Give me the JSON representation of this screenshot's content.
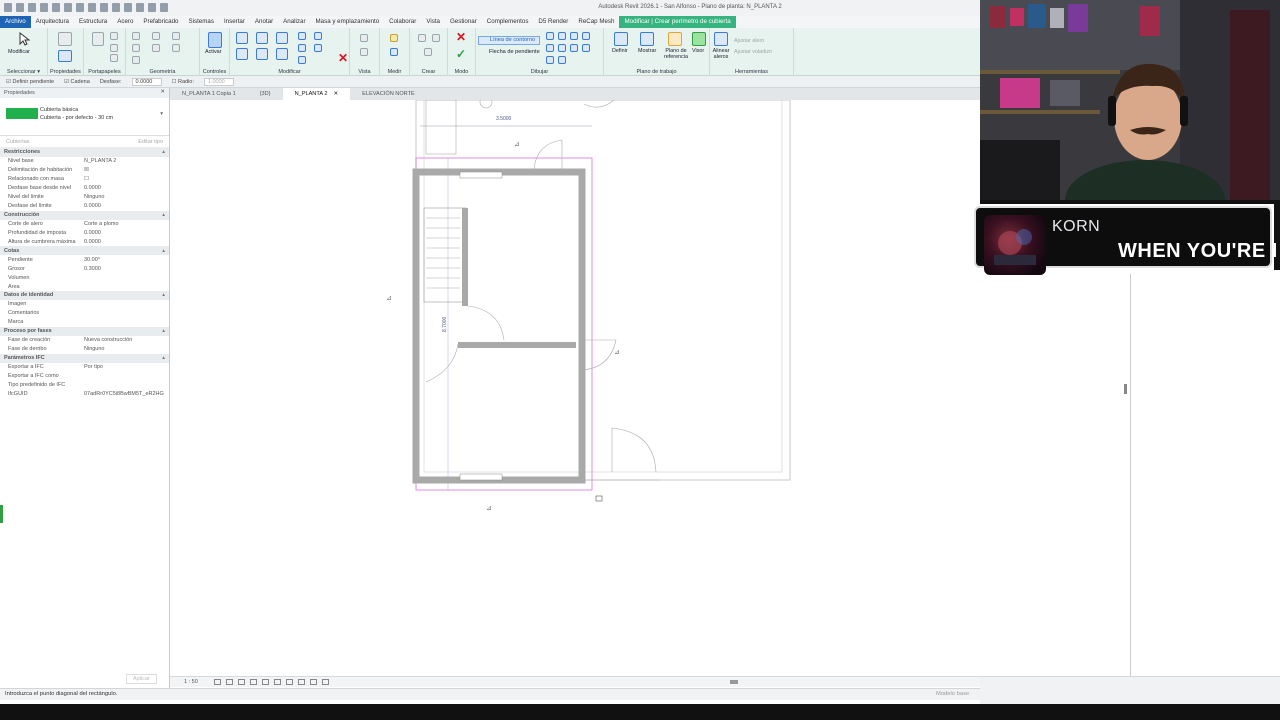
{
  "app": {
    "title": "Autodesk Revit 2026.1 - San Alfonso - Plano de planta: N_PLANTA 2"
  },
  "ribbon_tabs": [
    {
      "label": "Archivo",
      "state": "active"
    },
    {
      "label": "Arquitectura",
      "state": ""
    },
    {
      "label": "Estructura",
      "state": ""
    },
    {
      "label": "Acero",
      "state": ""
    },
    {
      "label": "Prefabricado",
      "state": ""
    },
    {
      "label": "Sistemas",
      "state": ""
    },
    {
      "label": "Insertar",
      "state": ""
    },
    {
      "label": "Anotar",
      "state": ""
    },
    {
      "label": "Analizar",
      "state": ""
    },
    {
      "label": "Masa y emplazamiento",
      "state": ""
    },
    {
      "label": "Colaborar",
      "state": ""
    },
    {
      "label": "Vista",
      "state": ""
    },
    {
      "label": "Gestionar",
      "state": ""
    },
    {
      "label": "Complementos",
      "state": ""
    },
    {
      "label": "D5 Render",
      "state": ""
    },
    {
      "label": "ReCap Mesh",
      "state": ""
    },
    {
      "label": "Modificar | Crear perímetro de cubierta",
      "state": "ctx"
    }
  ],
  "ribbon": {
    "modificar": "Modificar",
    "seleccionar": "Seleccionar ▾",
    "propiedades": "Propiedades",
    "portapapeles": "Portapapeles",
    "geometria": "Geometría",
    "activar": "Activar",
    "controles": "Controles",
    "modificar_group": "Modificar",
    "vista": "Vista",
    "medir": "Medir",
    "crear": "Crear",
    "modo": "Modo",
    "linea_contorno": "Línea de contorno",
    "flecha_pendiente": "Flecha de pendiente",
    "dibujar": "Dibujar",
    "definir": "Definir",
    "mostrar": "Mostrar",
    "plano_ref": "Plano de referencia",
    "visor": "Visor",
    "alinear_aleros": "Alinear aleros",
    "plano_trabajo": "Plano de trabajo",
    "herramientas": "Herramientas",
    "ajustar_alero": "Ajustar alero",
    "ajustar_voladizo": "Ajustar voladizo"
  },
  "options_bar": {
    "definir_pendiente": "Definir pendiente",
    "cadena": "Cadena",
    "desfase_label": "Desfase:",
    "desfase_value": "0.0000",
    "radio_label": "Radio:",
    "radio_value": "1.0000"
  },
  "properties": {
    "header": "Propiedades",
    "type_name": "Cubierta básica",
    "type_sub": "Cubierta - por defecto - 30 cm",
    "filter": "Cubiertas",
    "edit_type": "Editar tipo",
    "rows": [
      {
        "name": "Restricciones",
        "value": "",
        "sec": true
      },
      {
        "name": "Nivel base",
        "value": "N_PLANTA 2",
        "sec": false
      },
      {
        "name": "Delimitación de habitación",
        "value": "☒",
        "sec": false
      },
      {
        "name": "Relacionado con masa",
        "value": "☐",
        "sec": false
      },
      {
        "name": "Desfase base desde nivel",
        "value": "0.0000",
        "sec": false
      },
      {
        "name": "Nivel del límite",
        "value": "Ninguno",
        "sec": false
      },
      {
        "name": "Desfase del límite",
        "value": "0.0000",
        "sec": false
      },
      {
        "name": "Construcción",
        "value": "",
        "sec": true
      },
      {
        "name": "Corte de alero",
        "value": "Corte a plomo",
        "sec": false
      },
      {
        "name": "Profundidad de imposta",
        "value": "0.0000",
        "sec": false
      },
      {
        "name": "Altura de cumbrera máxima",
        "value": "0.0000",
        "sec": false
      },
      {
        "name": "Cotas",
        "value": "",
        "sec": true
      },
      {
        "name": "Pendiente",
        "value": "30.00°",
        "sec": false
      },
      {
        "name": "Grosor",
        "value": "0.3000",
        "sec": false
      },
      {
        "name": "Volumen",
        "value": "",
        "sec": false
      },
      {
        "name": "Área",
        "value": "",
        "sec": false
      },
      {
        "name": "Datos de identidad",
        "value": "",
        "sec": true
      },
      {
        "name": "Imagen",
        "value": "",
        "sec": false
      },
      {
        "name": "Comentarios",
        "value": "",
        "sec": false
      },
      {
        "name": "Marca",
        "value": "",
        "sec": false
      },
      {
        "name": "Proceso por fases",
        "value": "",
        "sec": true
      },
      {
        "name": "Fase de creación",
        "value": "Nueva construcción",
        "sec": false
      },
      {
        "name": "Fase de derribo",
        "value": "Ninguno",
        "sec": false
      },
      {
        "name": "Parámetros IFC",
        "value": "",
        "sec": true
      },
      {
        "name": "Exportar a IFC",
        "value": "Por tipo",
        "sec": false
      },
      {
        "name": "Exportar a IFC como",
        "value": "",
        "sec": false
      },
      {
        "name": "Tipo predefinido de IFC",
        "value": "",
        "sec": false
      },
      {
        "name": "IfcGUID",
        "value": "07adRr0YC5i8BwBM5T_eR2HG",
        "sec": false
      }
    ],
    "apply": "Aplicar"
  },
  "doc_tabs": [
    {
      "label": "N_PLANTA 1 Copia 1",
      "active": false
    },
    {
      "label": "{3D}",
      "active": false
    },
    {
      "label": "N_PLANTA 2",
      "active": true
    },
    {
      "label": "ELEVACIÓN NORTE",
      "active": false
    }
  ],
  "drawing": {
    "dim_horizontal": "3.5000",
    "dim_vertical": "8.7000"
  },
  "view_bar": {
    "scale": "1 : 50"
  },
  "status": {
    "message": "Introduzca el punto diagonal del rectángulo.",
    "model": "Modelo base"
  },
  "music": {
    "artist": "KORN",
    "song": "WHEN YOU'RE I"
  },
  "colors": {
    "accent": "#1f63b4",
    "context_tab": "#36b37e",
    "ribbon_bg": "#e6f3ee",
    "swatch": "#21b14c",
    "sketch": "#d45fd4",
    "wall": "#a9a9a9"
  }
}
